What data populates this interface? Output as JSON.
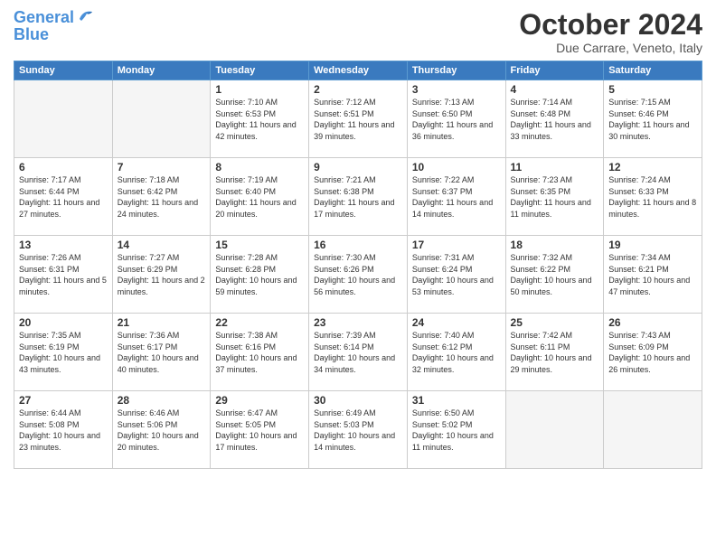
{
  "header": {
    "logo_line1": "General",
    "logo_line2": "Blue",
    "month": "October 2024",
    "location": "Due Carrare, Veneto, Italy"
  },
  "weekdays": [
    "Sunday",
    "Monday",
    "Tuesday",
    "Wednesday",
    "Thursday",
    "Friday",
    "Saturday"
  ],
  "weeks": [
    [
      {
        "day": "",
        "info": ""
      },
      {
        "day": "",
        "info": ""
      },
      {
        "day": "1",
        "info": "Sunrise: 7:10 AM\nSunset: 6:53 PM\nDaylight: 11 hours and 42 minutes."
      },
      {
        "day": "2",
        "info": "Sunrise: 7:12 AM\nSunset: 6:51 PM\nDaylight: 11 hours and 39 minutes."
      },
      {
        "day": "3",
        "info": "Sunrise: 7:13 AM\nSunset: 6:50 PM\nDaylight: 11 hours and 36 minutes."
      },
      {
        "day": "4",
        "info": "Sunrise: 7:14 AM\nSunset: 6:48 PM\nDaylight: 11 hours and 33 minutes."
      },
      {
        "day": "5",
        "info": "Sunrise: 7:15 AM\nSunset: 6:46 PM\nDaylight: 11 hours and 30 minutes."
      }
    ],
    [
      {
        "day": "6",
        "info": "Sunrise: 7:17 AM\nSunset: 6:44 PM\nDaylight: 11 hours and 27 minutes."
      },
      {
        "day": "7",
        "info": "Sunrise: 7:18 AM\nSunset: 6:42 PM\nDaylight: 11 hours and 24 minutes."
      },
      {
        "day": "8",
        "info": "Sunrise: 7:19 AM\nSunset: 6:40 PM\nDaylight: 11 hours and 20 minutes."
      },
      {
        "day": "9",
        "info": "Sunrise: 7:21 AM\nSunset: 6:38 PM\nDaylight: 11 hours and 17 minutes."
      },
      {
        "day": "10",
        "info": "Sunrise: 7:22 AM\nSunset: 6:37 PM\nDaylight: 11 hours and 14 minutes."
      },
      {
        "day": "11",
        "info": "Sunrise: 7:23 AM\nSunset: 6:35 PM\nDaylight: 11 hours and 11 minutes."
      },
      {
        "day": "12",
        "info": "Sunrise: 7:24 AM\nSunset: 6:33 PM\nDaylight: 11 hours and 8 minutes."
      }
    ],
    [
      {
        "day": "13",
        "info": "Sunrise: 7:26 AM\nSunset: 6:31 PM\nDaylight: 11 hours and 5 minutes."
      },
      {
        "day": "14",
        "info": "Sunrise: 7:27 AM\nSunset: 6:29 PM\nDaylight: 11 hours and 2 minutes."
      },
      {
        "day": "15",
        "info": "Sunrise: 7:28 AM\nSunset: 6:28 PM\nDaylight: 10 hours and 59 minutes."
      },
      {
        "day": "16",
        "info": "Sunrise: 7:30 AM\nSunset: 6:26 PM\nDaylight: 10 hours and 56 minutes."
      },
      {
        "day": "17",
        "info": "Sunrise: 7:31 AM\nSunset: 6:24 PM\nDaylight: 10 hours and 53 minutes."
      },
      {
        "day": "18",
        "info": "Sunrise: 7:32 AM\nSunset: 6:22 PM\nDaylight: 10 hours and 50 minutes."
      },
      {
        "day": "19",
        "info": "Sunrise: 7:34 AM\nSunset: 6:21 PM\nDaylight: 10 hours and 47 minutes."
      }
    ],
    [
      {
        "day": "20",
        "info": "Sunrise: 7:35 AM\nSunset: 6:19 PM\nDaylight: 10 hours and 43 minutes."
      },
      {
        "day": "21",
        "info": "Sunrise: 7:36 AM\nSunset: 6:17 PM\nDaylight: 10 hours and 40 minutes."
      },
      {
        "day": "22",
        "info": "Sunrise: 7:38 AM\nSunset: 6:16 PM\nDaylight: 10 hours and 37 minutes."
      },
      {
        "day": "23",
        "info": "Sunrise: 7:39 AM\nSunset: 6:14 PM\nDaylight: 10 hours and 34 minutes."
      },
      {
        "day": "24",
        "info": "Sunrise: 7:40 AM\nSunset: 6:12 PM\nDaylight: 10 hours and 32 minutes."
      },
      {
        "day": "25",
        "info": "Sunrise: 7:42 AM\nSunset: 6:11 PM\nDaylight: 10 hours and 29 minutes."
      },
      {
        "day": "26",
        "info": "Sunrise: 7:43 AM\nSunset: 6:09 PM\nDaylight: 10 hours and 26 minutes."
      }
    ],
    [
      {
        "day": "27",
        "info": "Sunrise: 6:44 AM\nSunset: 5:08 PM\nDaylight: 10 hours and 23 minutes."
      },
      {
        "day": "28",
        "info": "Sunrise: 6:46 AM\nSunset: 5:06 PM\nDaylight: 10 hours and 20 minutes."
      },
      {
        "day": "29",
        "info": "Sunrise: 6:47 AM\nSunset: 5:05 PM\nDaylight: 10 hours and 17 minutes."
      },
      {
        "day": "30",
        "info": "Sunrise: 6:49 AM\nSunset: 5:03 PM\nDaylight: 10 hours and 14 minutes."
      },
      {
        "day": "31",
        "info": "Sunrise: 6:50 AM\nSunset: 5:02 PM\nDaylight: 10 hours and 11 minutes."
      },
      {
        "day": "",
        "info": ""
      },
      {
        "day": "",
        "info": ""
      }
    ]
  ]
}
